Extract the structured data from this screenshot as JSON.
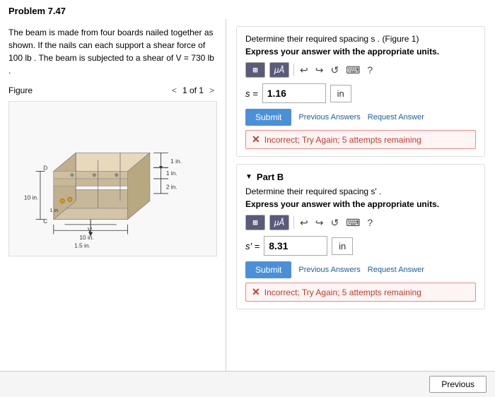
{
  "problem": {
    "number": "Problem 7.47",
    "description": "The beam is made from four boards nailed together as shown. If the nails can each support a shear force of 100 lb . The beam is subjected to a shear of V = 730 lb .",
    "figure_label": "Figure",
    "figure_page": "1 of 1"
  },
  "part_a": {
    "intro": "Determine their required spacing s .",
    "figure_ref": "(Figure 1)",
    "instruction": "Express your answer with the appropriate units.",
    "answer_label": "s =",
    "answer_value": "1.16",
    "unit": "in",
    "submit_label": "Submit",
    "prev_answers_label": "Previous Answers",
    "request_answer_label": "Request Answer",
    "feedback": "Incorrect; Try Again; 5 attempts remaining"
  },
  "part_b": {
    "label": "Part B",
    "intro": "Determine their required spacing s' .",
    "instruction": "Express your answer with the appropriate units.",
    "answer_label": "s' =",
    "answer_value": "8.31",
    "unit": "in",
    "submit_label": "Submit",
    "prev_answers_label": "Previous Answers",
    "request_answer_label": "Request Answer",
    "feedback": "Incorrect; Try Again; 5 attempts remaining"
  },
  "bottom": {
    "prev_button": "Previous"
  },
  "icons": {
    "undo": "↺",
    "redo": "↻",
    "refresh": "↺",
    "help": "?",
    "grid": "⊞",
    "mu": "μÅ"
  }
}
